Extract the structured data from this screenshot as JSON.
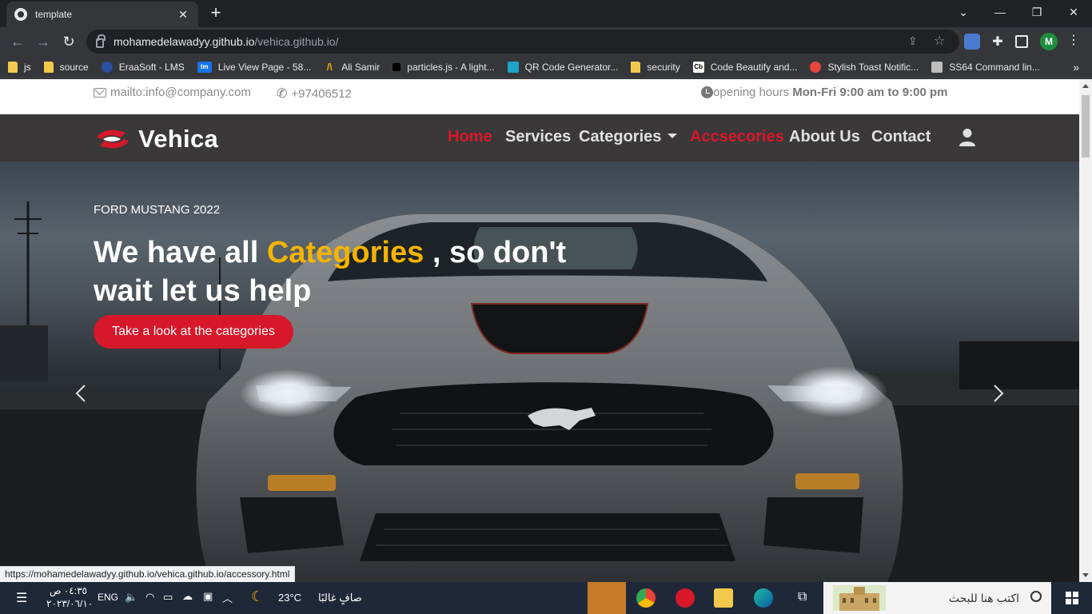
{
  "browser": {
    "tab_title": "template",
    "url_host": "mohamedelawadyy.github.io",
    "url_path": "/vehica.github.io/",
    "profile_initial": "M",
    "status_url": "https://mohamedelawadyy.github.io/vehica.github.io/accessory.html"
  },
  "bookmarks": [
    {
      "label": "js",
      "icon": "folder-icon"
    },
    {
      "label": "source",
      "icon": "folder-icon"
    },
    {
      "label": "EraaSoft - LMS",
      "icon": "eraasoft-icon"
    },
    {
      "label": "Live View Page - 58...",
      "icon": "tm-icon",
      "badge": "tm"
    },
    {
      "label": "Ali Samir",
      "icon": "ali-samir-icon"
    },
    {
      "label": "particles.js - A light...",
      "icon": "particles-icon"
    },
    {
      "label": "QR Code Generator...",
      "icon": "qr-icon"
    },
    {
      "label": "security",
      "icon": "folder-icon"
    },
    {
      "label": "Code Beautify and...",
      "icon": "codebeautify-icon",
      "badge": "Cb"
    },
    {
      "label": "Stylish Toast Notific...",
      "icon": "toast-icon"
    },
    {
      "label": "SS64 Command lin...",
      "icon": "ss64-icon"
    }
  ],
  "site": {
    "topbar": {
      "email": "mailto:info@company.com",
      "phone": "+97406512",
      "hours_label": "opening hours",
      "hours_value": "Mon-Fri 9:00 am to 9:00 pm"
    },
    "brand": "Vehica",
    "nav": {
      "home": "Home",
      "services": "Services",
      "categories": "Categories",
      "accessories": "Accsecories",
      "about": "About Us",
      "contact": "Contact"
    },
    "hero": {
      "eyebrow": "FORD MUSTANG 2022",
      "headline_pre": "We have all ",
      "headline_accent": "Categories",
      "headline_post": " , so don't wait let us help",
      "cta": "Take a look at the categories"
    }
  },
  "taskbar": {
    "time": "٠٤:٣٥ ص",
    "date": "٢٠٢٣/٠٦/١٠",
    "lang": "ENG",
    "weather_temp": "23°C",
    "weather_desc": "صافٍ غالبًا",
    "search_placeholder": "اكتب هنا للبحث"
  }
}
